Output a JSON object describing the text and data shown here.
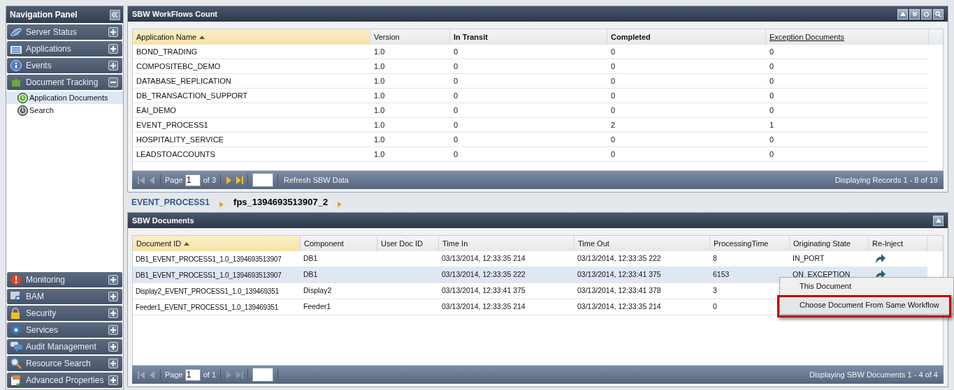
{
  "nav": {
    "title": "Navigation Panel",
    "top_items": [
      {
        "label": "Server Status",
        "expanded": false
      },
      {
        "label": "Applications",
        "expanded": false
      },
      {
        "label": "Events",
        "expanded": false
      },
      {
        "label": "Document Tracking",
        "expanded": true,
        "children": [
          {
            "label": "Application Documents",
            "selected": true
          },
          {
            "label": "Search",
            "selected": false
          }
        ]
      }
    ],
    "bottom_items": [
      {
        "label": "Monitoring",
        "expanded": false
      },
      {
        "label": "BAM",
        "expanded": false
      },
      {
        "label": "Security",
        "expanded": false
      },
      {
        "label": "Services",
        "expanded": false
      },
      {
        "label": "Audit Management",
        "expanded": false
      },
      {
        "label": "Resource Search",
        "expanded": false
      },
      {
        "label": "Advanced Properties",
        "expanded": false
      }
    ]
  },
  "workflows": {
    "title": "SBW WorkFlows Count",
    "columns": [
      {
        "label": "Application Name",
        "kind": "sorted"
      },
      {
        "label": "Version",
        "kind": "plain"
      },
      {
        "label": "In Transit",
        "kind": "bold"
      },
      {
        "label": "Completed",
        "kind": "bold"
      },
      {
        "label": "Exception Documents",
        "kind": "link"
      }
    ],
    "rows": [
      [
        "BOND_TRADING",
        "1.0",
        "0",
        "0",
        "0"
      ],
      [
        "COMPOSITEBC_DEMO",
        "1.0",
        "0",
        "0",
        "0"
      ],
      [
        "DATABASE_REPLICATION",
        "1.0",
        "0",
        "0",
        "0"
      ],
      [
        "DB_TRANSACTION_SUPPORT",
        "1.0",
        "0",
        "0",
        "0"
      ],
      [
        "EAI_DEMO",
        "1.0",
        "0",
        "0",
        "0"
      ],
      [
        "EVENT_PROCESS1",
        "1.0",
        "0",
        "2",
        "1"
      ],
      [
        "HOSPITALITY_SERVICE",
        "1.0",
        "0",
        "0",
        "0"
      ],
      [
        "LEADSTOACCOUNTS",
        "1.0",
        "0",
        "0",
        "0"
      ]
    ],
    "pager": {
      "page_label": "Page",
      "page": "1",
      "of": "of 3",
      "back_enabled": false,
      "forward_enabled": true,
      "refresh": "Refresh SBW Data",
      "summary": "Displaying Records 1 - 8 of 19"
    }
  },
  "breadcrumb": [
    {
      "label": "EVENT_PROCESS1",
      "kind": "link"
    },
    {
      "label": "fps_1394693513907_2",
      "kind": "current"
    }
  ],
  "documents": {
    "title": "SBW Documents",
    "columns": [
      {
        "label": "Document ID",
        "kind": "sorted"
      },
      {
        "label": "Component",
        "kind": "plain"
      },
      {
        "label": "User Doc ID",
        "kind": "plain"
      },
      {
        "label": "Time In",
        "kind": "plain"
      },
      {
        "label": "Time Out",
        "kind": "plain"
      },
      {
        "label": "ProcessingTime",
        "kind": "plain"
      },
      {
        "label": "Originating State",
        "kind": "plain"
      },
      {
        "label": "Re-Inject",
        "kind": "plain"
      }
    ],
    "rows": [
      {
        "cells": [
          "DB1_EVENT_PROCESS1_1.0_1394693513907",
          "DB1",
          "",
          "03/13/2014, 12:33:35 214",
          "03/13/2014, 12:33:35 222",
          "8",
          "IN_PORT"
        ],
        "reinject": true,
        "selected": false
      },
      {
        "cells": [
          "DB1_EVENT_PROCESS1_1.0_1394693513907",
          "DB1",
          "",
          "03/13/2014, 12:33:35 222",
          "03/13/2014, 12:33:41 375",
          "6153",
          "ON_EXCEPTION"
        ],
        "reinject": true,
        "selected": true
      },
      {
        "cells": [
          "Display2_EVENT_PROCESS1_1.0_139469351",
          "Display2",
          "",
          "03/13/2014, 12:33:41 375",
          "03/13/2014, 12:33:41 378",
          "3"
        ],
        "reinject": false,
        "selected": false
      },
      {
        "cells": [
          "Feeder1_EVENT_PROCESS1_1.0_139469351",
          "Feeder1",
          "",
          "03/13/2014, 12:33:35 214",
          "03/13/2014, 12:33:35 214",
          "0"
        ],
        "reinject": false,
        "selected": false
      }
    ],
    "pager": {
      "page_label": "Page",
      "page": "1",
      "of": "of 1",
      "back_enabled": false,
      "forward_enabled": false,
      "summary": "Displaying SBW Documents 1 - 4 of 4"
    }
  },
  "context_menu": [
    {
      "label": "This Document",
      "highlighted": false
    },
    {
      "label": "Choose Document From Same Workflow",
      "highlighted": true
    }
  ]
}
